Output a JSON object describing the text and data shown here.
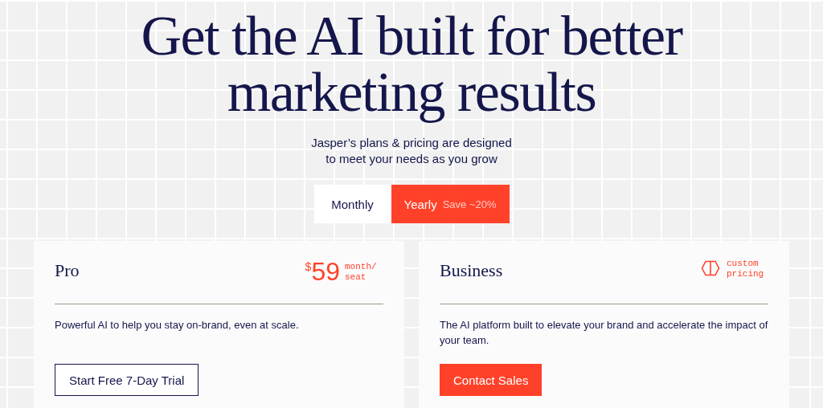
{
  "headline": "Get the AI built for better marketing results",
  "subtitle": "Jasper’s plans & pricing are designed to meet your needs as you grow",
  "billing_toggle": [
    {
      "label": "Monthly",
      "selected": false
    },
    {
      "label": "Yearly",
      "note": "Save ~20%",
      "selected": true
    }
  ],
  "plans": [
    {
      "name": "Pro",
      "kind": "price",
      "currency": "$",
      "amount": "59",
      "unit": "month/ seat",
      "description": "Powerful AI to help you stay on-brand, even at scale.",
      "button": {
        "label": "Start Free 7-Day Trial",
        "kind": "outline"
      }
    },
    {
      "name": "Business",
      "kind": "custom",
      "unit": "custom pricing",
      "description": "The AI platform built to elevate your brand and accelerate the impact of your team.",
      "button": {
        "label": "Contact Sales",
        "kind": "filled"
      }
    }
  ]
}
